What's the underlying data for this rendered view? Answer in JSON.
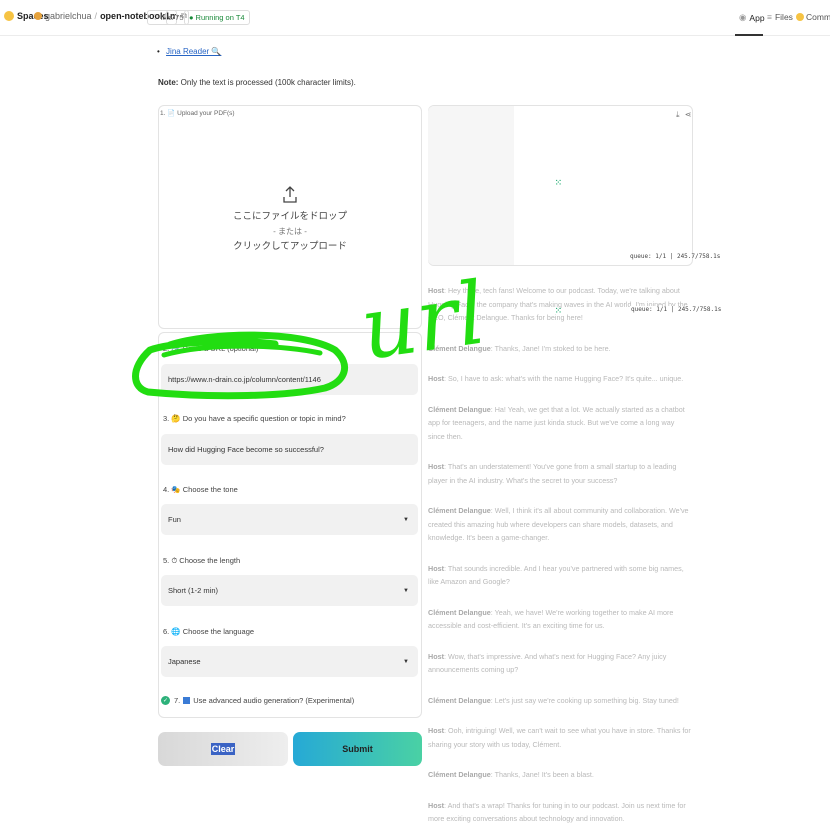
{
  "topbar": {
    "spaces": "Spaces",
    "owner": "gabrielchua",
    "repo": "open-notebook1m",
    "like": "like",
    "like_count": "775",
    "running": "Running on T4",
    "tabs": [
      "App",
      "Files",
      "Communi"
    ]
  },
  "left": {
    "link": "Jina Reader 🔍",
    "note_bold": "Note:",
    "note_text": " Only the text is processed (100k character limits).",
    "upload_label": "1. 📄 Upload your PDF(s)",
    "upload_drop": "ここにファイルをドロップ",
    "upload_or": "- または -",
    "upload_click": "クリックしてアップロード"
  },
  "form": {
    "url_label": "2. 🔗 Paste a URL (optional)",
    "url_value": "https://www.n-drain.co.jp/column/content/1146",
    "question_label": "3. 🤔 Do you have a specific question or topic in mind?",
    "question_value": "How did Hugging Face become so successful?",
    "tone_label": "4. 🎭 Choose the tone",
    "tone_value": "Fun",
    "length_label": "5. ⏱ Choose the length",
    "length_value": "Short (1-2 min)",
    "language_label": "6. 🌐 Choose the language",
    "language_value": "Japanese",
    "advanced_num": "7.",
    "advanced_label": "Use advanced audio generation? (Experimental)",
    "clear": "Clear",
    "submit": "Submit"
  },
  "audio": {
    "queue_top": "queue: 1/1  |  245.7/758.1s",
    "queue_bottom": "queue: 1/1  |  245.7/758.1s"
  },
  "transcript": [
    {
      "speaker": "Host",
      "text": "Hey there, tech fans! Welcome to our podcast. Today, we're talking about Hugging Face, the company that's making waves in the AI world. I'm joined by the CEO, Clément Delangue. Thanks for being here!"
    },
    {
      "speaker": "Clément Delangue",
      "text": "Thanks, Jane! I'm stoked to be here."
    },
    {
      "speaker": "Host",
      "text": "So, I have to ask: what's with the name Hugging Face? It's quite... unique."
    },
    {
      "speaker": "Clément Delangue",
      "text": "Ha! Yeah, we get that a lot. We actually started as a chatbot app for teenagers, and the name just kinda stuck. But we've come a long way since then."
    },
    {
      "speaker": "Host",
      "text": "That's an understatement! You've gone from a small startup to a leading player in the AI industry. What's the secret to your success?"
    },
    {
      "speaker": "Clément Delangue",
      "text": "Well, I think it's all about community and collaboration. We've created this amazing hub where developers can share models, datasets, and knowledge. It's been a game-changer."
    },
    {
      "speaker": "Host",
      "text": "That sounds incredible. And I hear you've partnered with some big names, like Amazon and Google?"
    },
    {
      "speaker": "Clément Delangue",
      "text": "Yeah, we have! We're working together to make AI more accessible and cost-efficient. It's an exciting time for us."
    },
    {
      "speaker": "Host",
      "text": "Wow, that's impressive. And what's next for Hugging Face? Any juicy announcements coming up?"
    },
    {
      "speaker": "Clément Delangue",
      "text": "Let's just say we're cooking up something big. Stay tuned!"
    },
    {
      "speaker": "Host",
      "text": "Ooh, intriguing! Well, we can't wait to see what you have in store. Thanks for sharing your story with us today, Clément."
    },
    {
      "speaker": "Clément Delangue",
      "text": "Thanks, Jane! It's been a blast."
    },
    {
      "speaker": "Host",
      "text": "And that's a wrap! Thanks for tuning in to our podcast. Join us next time for more exciting conversations about technology and innovation."
    }
  ],
  "annotation": {
    "text": "url",
    "color": "#22dd11"
  },
  "colors": {
    "accent_green": "#2db17a",
    "link_blue": "#2664c4",
    "submit_start": "#26a9d6",
    "submit_end": "#4ad1a4"
  }
}
